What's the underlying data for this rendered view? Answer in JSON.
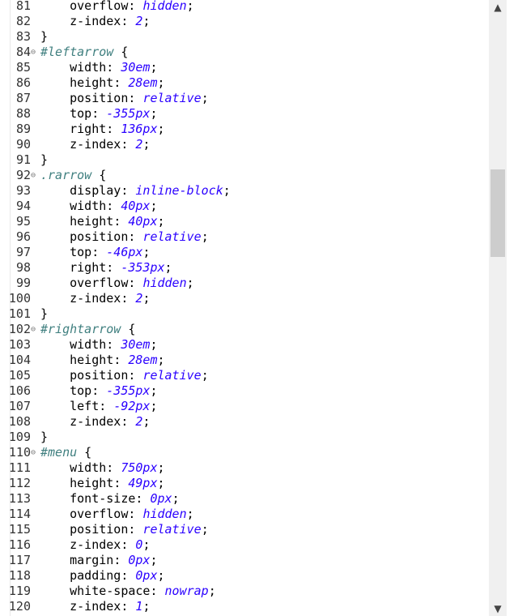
{
  "editor": {
    "lines": [
      {
        "n": "81",
        "kind": "decl",
        "prop": "overflow",
        "val": "hidden"
      },
      {
        "n": "82",
        "kind": "decl",
        "prop": "z-index",
        "val": "2"
      },
      {
        "n": "83",
        "kind": "close"
      },
      {
        "n": "84",
        "kind": "rule",
        "sel": "#leftarrow",
        "fold": "⊖"
      },
      {
        "n": "85",
        "kind": "decl",
        "prop": "width",
        "val": "30em"
      },
      {
        "n": "86",
        "kind": "decl",
        "prop": "height",
        "val": "28em"
      },
      {
        "n": "87",
        "kind": "decl",
        "prop": "position",
        "val": "relative"
      },
      {
        "n": "88",
        "kind": "decl",
        "prop": "top",
        "val": "-355px"
      },
      {
        "n": "89",
        "kind": "decl",
        "prop": "right",
        "val": "136px"
      },
      {
        "n": "90",
        "kind": "decl",
        "prop": "z-index",
        "val": "2"
      },
      {
        "n": "91",
        "kind": "close"
      },
      {
        "n": "92",
        "kind": "rule",
        "sel": ".rarrow",
        "fold": "⊖"
      },
      {
        "n": "93",
        "kind": "decl",
        "prop": "display",
        "val": "inline-block"
      },
      {
        "n": "94",
        "kind": "decl",
        "prop": "width",
        "val": "40px"
      },
      {
        "n": "95",
        "kind": "decl",
        "prop": "height",
        "val": "40px"
      },
      {
        "n": "96",
        "kind": "decl",
        "prop": "position",
        "val": "relative"
      },
      {
        "n": "97",
        "kind": "decl",
        "prop": "top",
        "val": "-46px"
      },
      {
        "n": "98",
        "kind": "decl",
        "prop": "right",
        "val": "-353px"
      },
      {
        "n": "99",
        "kind": "decl",
        "prop": "overflow",
        "val": "hidden"
      },
      {
        "n": "100",
        "kind": "decl",
        "prop": "z-index",
        "val": "2"
      },
      {
        "n": "101",
        "kind": "close"
      },
      {
        "n": "102",
        "kind": "rule",
        "sel": "#rightarrow",
        "fold": "⊖"
      },
      {
        "n": "103",
        "kind": "decl",
        "prop": "width",
        "val": "30em"
      },
      {
        "n": "104",
        "kind": "decl",
        "prop": "height",
        "val": "28em"
      },
      {
        "n": "105",
        "kind": "decl",
        "prop": "position",
        "val": "relative"
      },
      {
        "n": "106",
        "kind": "decl",
        "prop": "top",
        "val": "-355px"
      },
      {
        "n": "107",
        "kind": "decl",
        "prop": "left",
        "val": "-92px"
      },
      {
        "n": "108",
        "kind": "decl",
        "prop": "z-index",
        "val": "2"
      },
      {
        "n": "109",
        "kind": "close"
      },
      {
        "n": "110",
        "kind": "rule",
        "sel": "#menu",
        "fold": "⊖"
      },
      {
        "n": "111",
        "kind": "decl",
        "prop": "width",
        "val": "750px"
      },
      {
        "n": "112",
        "kind": "decl",
        "prop": "height",
        "val": "49px"
      },
      {
        "n": "113",
        "kind": "decl",
        "prop": "font-size",
        "val": "0px"
      },
      {
        "n": "114",
        "kind": "decl",
        "prop": "overflow",
        "val": "hidden"
      },
      {
        "n": "115",
        "kind": "decl",
        "prop": "position",
        "val": "relative"
      },
      {
        "n": "116",
        "kind": "decl",
        "prop": "z-index",
        "val": "0"
      },
      {
        "n": "117",
        "kind": "decl",
        "prop": "margin",
        "val": "0px"
      },
      {
        "n": "118",
        "kind": "decl",
        "prop": "padding",
        "val": "0px"
      },
      {
        "n": "119",
        "kind": "decl",
        "prop": "white-space",
        "val": "nowrap"
      },
      {
        "n": "120",
        "kind": "decl",
        "prop": "z-index",
        "val": "1"
      }
    ]
  },
  "scrollbar": {
    "up_icon": "▲",
    "down_icon": "▼",
    "scroll_position": 0.31
  },
  "colors": {
    "selector": "#3f7f7f",
    "value": "#2a00ff",
    "text": "#000000"
  }
}
